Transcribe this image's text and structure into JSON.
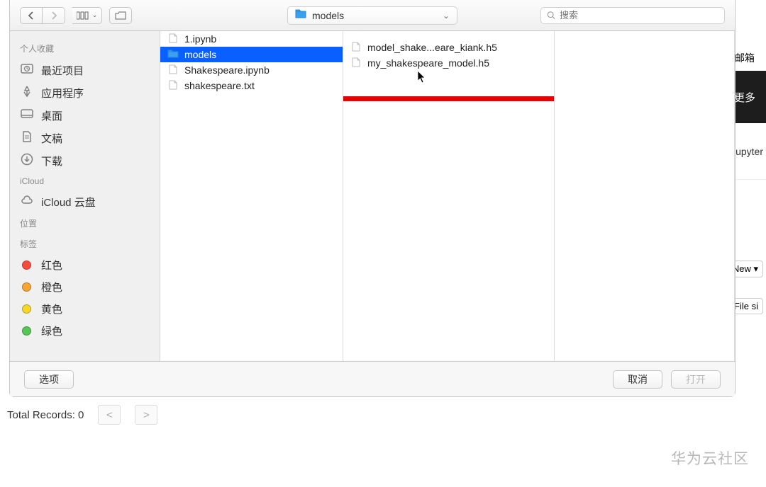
{
  "toolbar": {
    "location_label": "models",
    "search_placeholder": "搜索"
  },
  "sidebar": {
    "sections": [
      {
        "header": "个人收藏",
        "items": [
          {
            "icon": "clock",
            "label": "最近项目"
          },
          {
            "icon": "apps",
            "label": "应用程序"
          },
          {
            "icon": "desktop",
            "label": "桌面"
          },
          {
            "icon": "docs",
            "label": "文稿"
          },
          {
            "icon": "downloads",
            "label": "下载"
          }
        ]
      },
      {
        "header": "iCloud",
        "items": [
          {
            "icon": "cloud",
            "label": "iCloud 云盘"
          }
        ]
      },
      {
        "header": "位置",
        "items": []
      },
      {
        "header": "标签",
        "items": [
          {
            "color": "#f74c3c",
            "label": "红色"
          },
          {
            "color": "#f6a534",
            "label": "橙色"
          },
          {
            "color": "#f5d629",
            "label": "黄色"
          },
          {
            "color": "#56c756",
            "label": "绿色"
          }
        ]
      }
    ]
  },
  "columns": {
    "c1": [
      {
        "type": "file",
        "name": "1.ipynb",
        "selected": false
      },
      {
        "type": "folder",
        "name": "models",
        "selected": true
      },
      {
        "type": "file",
        "name": "Shakespeare.ipynb",
        "selected": false
      },
      {
        "type": "file",
        "name": "shakespeare.txt",
        "selected": false
      }
    ],
    "c2": [
      {
        "type": "file",
        "name": "model_shake...eare_kiank.h5"
      },
      {
        "type": "file",
        "name": "my_shakespeare_model.h5"
      }
    ]
  },
  "buttons": {
    "options": "选项",
    "cancel": "取消",
    "open": "打开"
  },
  "below": {
    "total_records": "Total Records: 0",
    "prev": "<",
    "next": ">"
  },
  "watermark": "华为云社区",
  "right_bg": {
    "mail": "邮箱",
    "more": "更多",
    "jupyter": "Jupyter",
    "new": "New ▾",
    "filesize": "File si"
  }
}
